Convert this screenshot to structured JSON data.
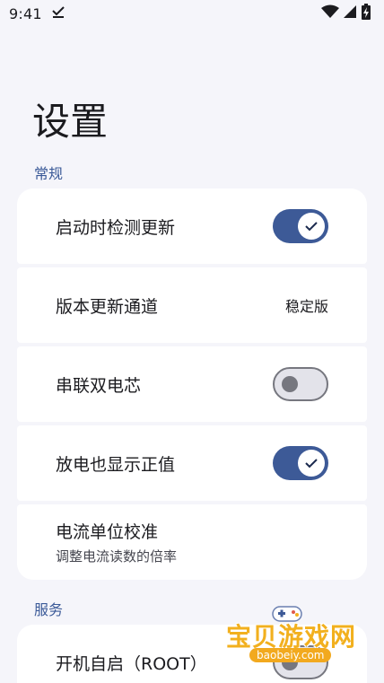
{
  "status_bar": {
    "time": "9:41"
  },
  "title": "设置",
  "sections": [
    {
      "header": "常规",
      "items": [
        {
          "label": "启动时检测更新",
          "control": "switch",
          "on": true
        },
        {
          "label": "版本更新通道",
          "control": "value",
          "value": "稳定版"
        },
        {
          "label": "串联双电芯",
          "control": "switch",
          "on": false
        },
        {
          "label": "放电也显示正值",
          "control": "switch",
          "on": true
        },
        {
          "label": "电流单位校准",
          "sublabel": "调整电流读数的倍率",
          "control": "none"
        }
      ]
    },
    {
      "header": "服务",
      "items": [
        {
          "label": "开机自启（ROOT）",
          "control": "switch",
          "on": false
        }
      ]
    }
  ],
  "watermark": {
    "text": "宝贝游戏网",
    "url": "baobeiy.com"
  },
  "colors": {
    "accent": "#3d5a97",
    "background": "#f5f5fa",
    "card": "#ffffff",
    "section_header": "#3b5a98"
  }
}
